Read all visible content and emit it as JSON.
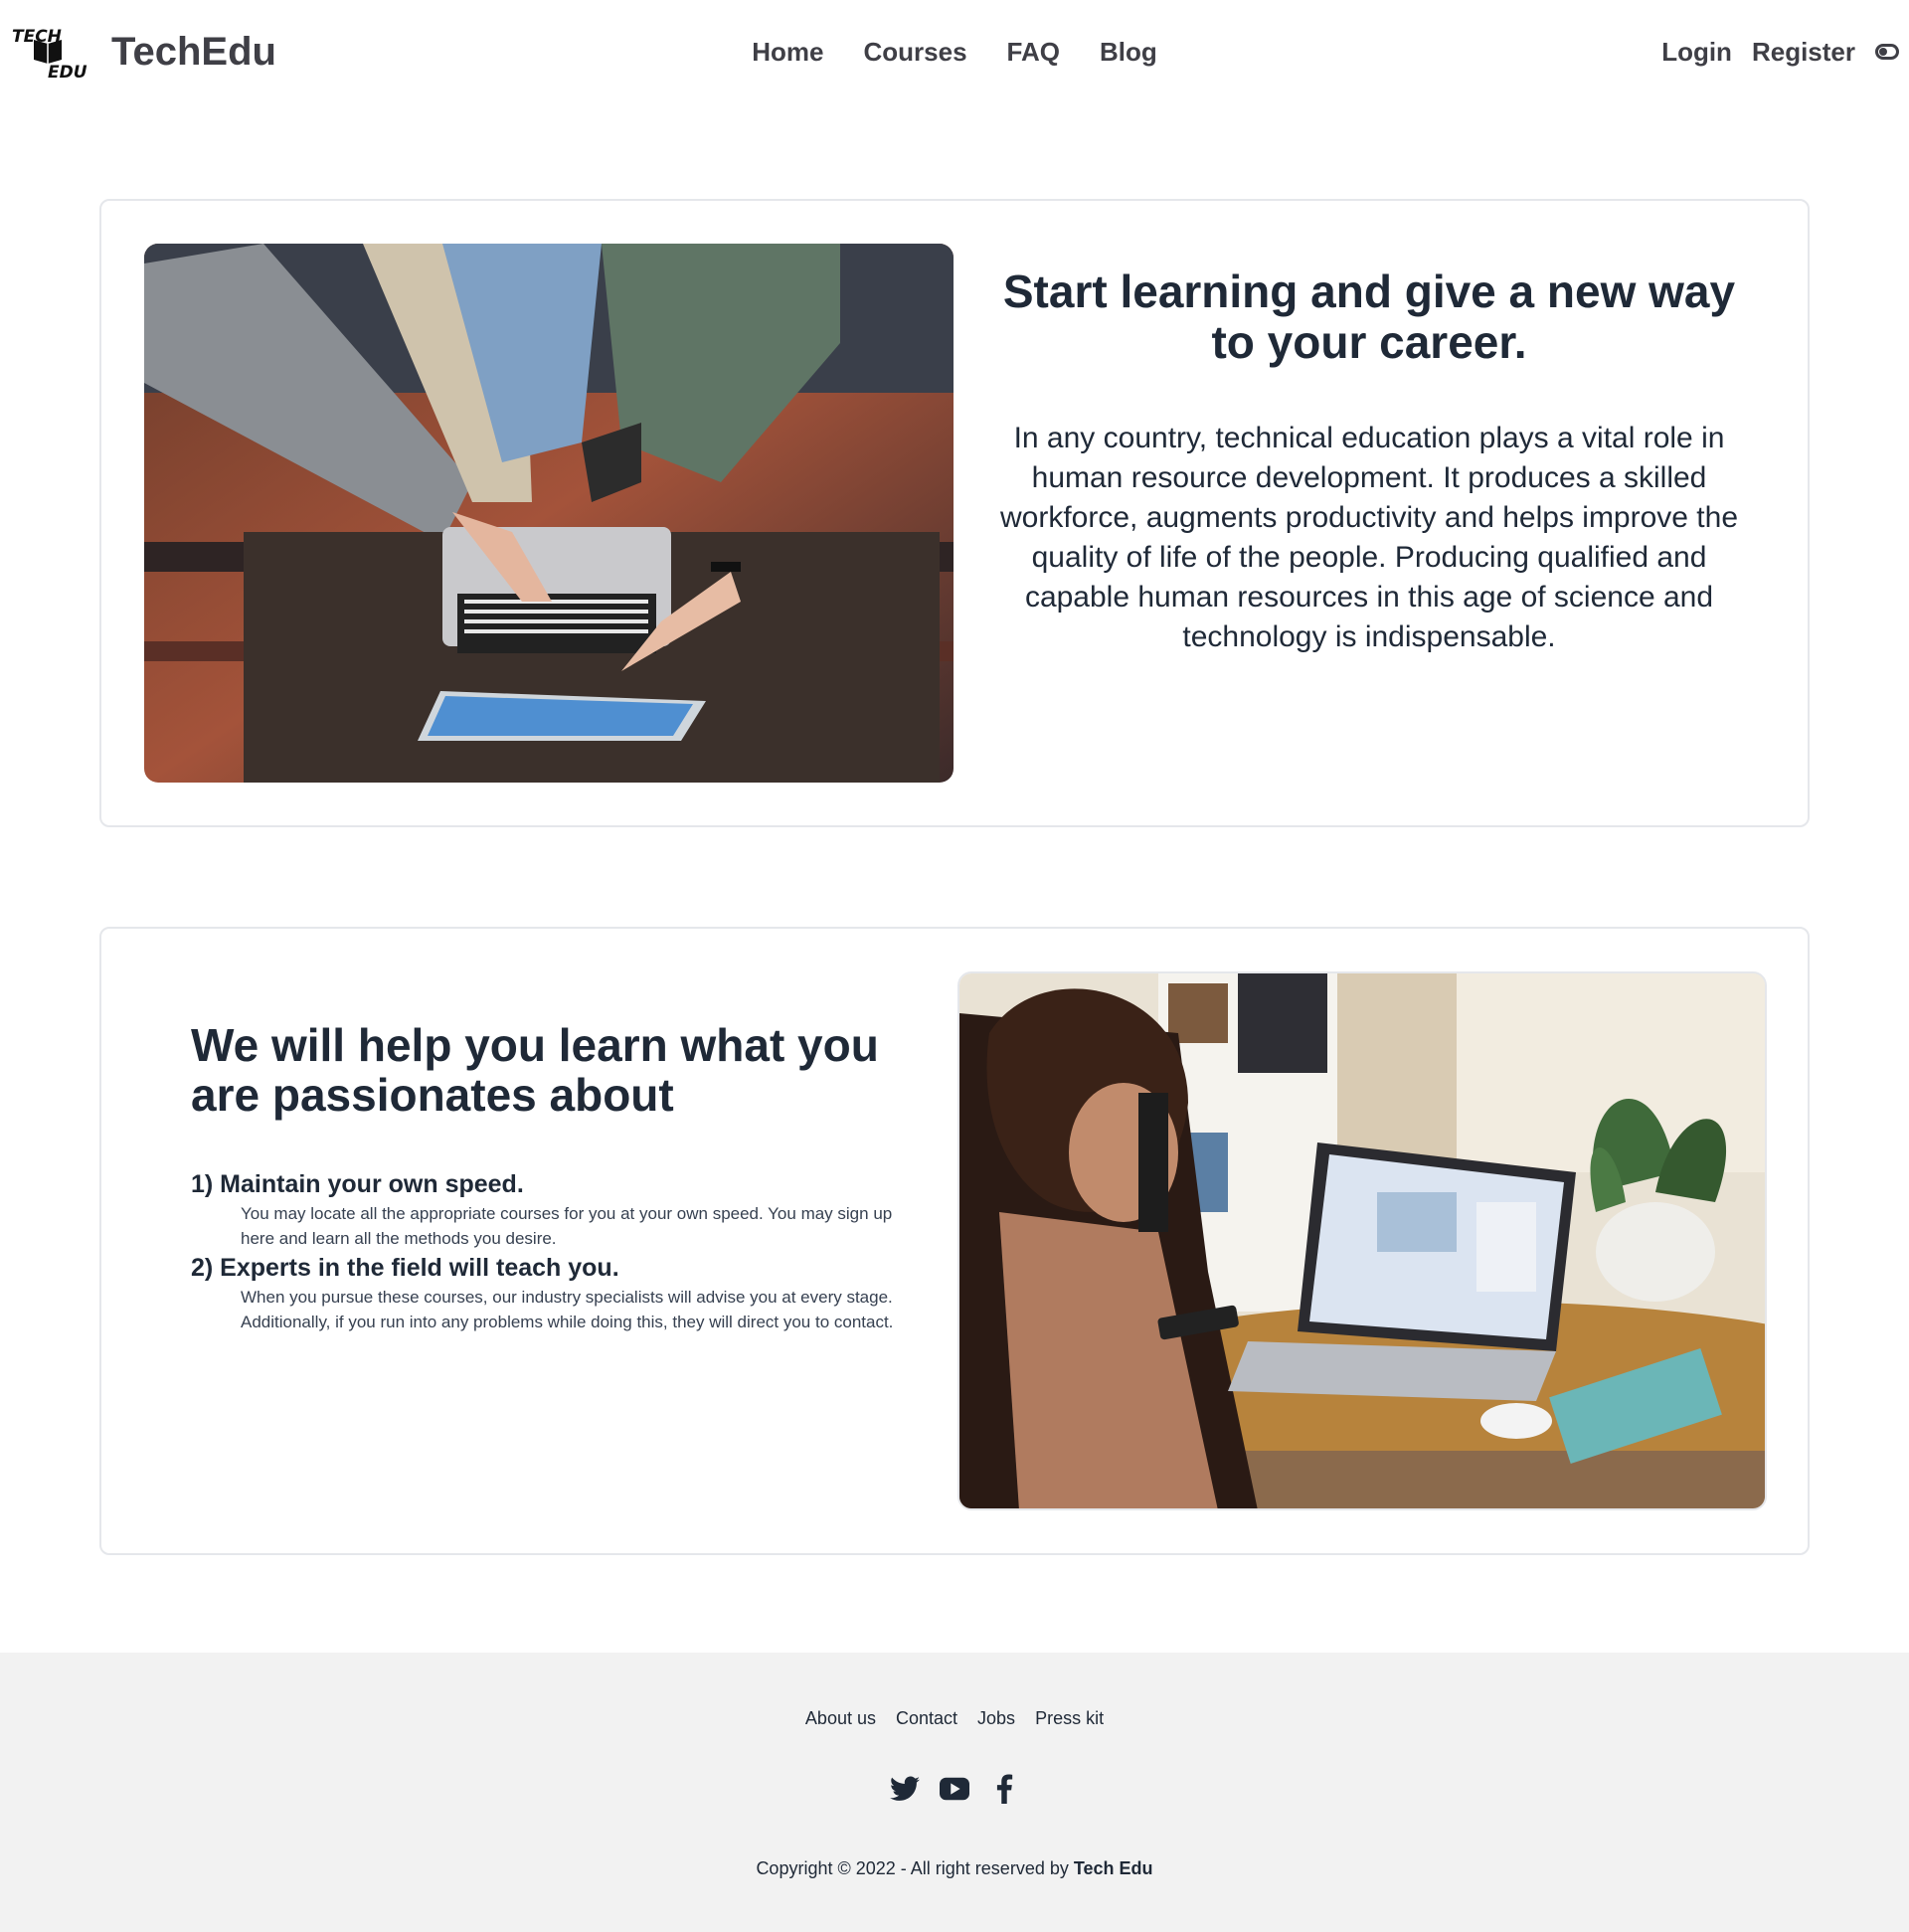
{
  "nav": {
    "logo_text_top": "TECH",
    "logo_text_bottom": "EDU",
    "brand": "TechEdu",
    "links": [
      "Home",
      "Courses",
      "FAQ",
      "Blog"
    ],
    "login": "Login",
    "register": "Register",
    "theme_toggle_icon": "toggle-icon"
  },
  "hero": {
    "title": "Start learning and give a new way to your career.",
    "text": "In any country, technical education plays a vital role in human resource development. It produces a skilled workforce, augments productivity and helps improve the quality of life of the people. Producing qualified and capable human resources in this age of science and technology is indispensable."
  },
  "features": {
    "title": "We will help you learn what you are passionates about",
    "items": [
      {
        "title": "1) Maintain your own speed.",
        "body": "You may locate all the appropriate courses for you at your own speed. You may sign up here and learn all the methods you desire."
      },
      {
        "title": "2) Experts in the field will teach you.",
        "body": "When you pursue these courses, our industry specialists will advise you at every stage. Additionally, if you run into any problems while doing this, they will direct you to contact."
      }
    ]
  },
  "footer": {
    "links": [
      "About us",
      "Contact",
      "Jobs",
      "Press kit"
    ],
    "socials": [
      "twitter-icon",
      "youtube-icon",
      "facebook-icon"
    ],
    "copyright_prefix": "Copyright © 2022 - All right reserved by ",
    "copyright_brand": "Tech Edu"
  }
}
